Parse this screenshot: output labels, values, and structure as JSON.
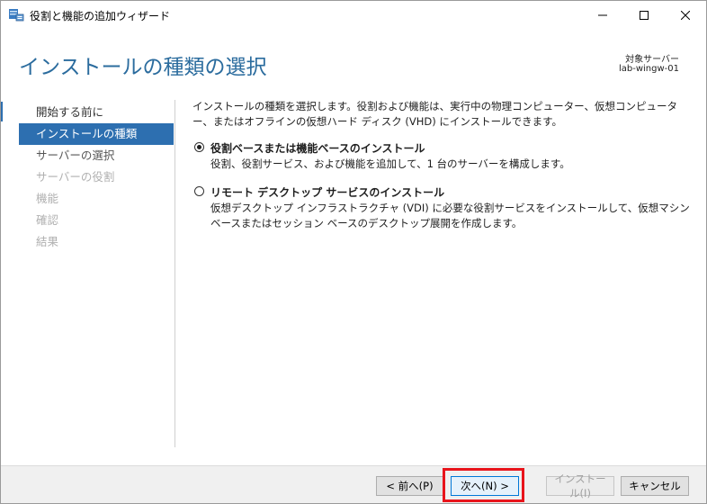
{
  "window": {
    "title": "役割と機能の追加ウィザード",
    "page_title": "インストールの種類の選択",
    "target_label": "対象サーバー",
    "target_name": "lab-wingw-01"
  },
  "nav": {
    "items": [
      {
        "label": "開始する前に",
        "state": "done"
      },
      {
        "label": "インストールの種類",
        "state": "active"
      },
      {
        "label": "サーバーの選択",
        "state": "next"
      },
      {
        "label": "サーバーの役割",
        "state": "disabled"
      },
      {
        "label": "機能",
        "state": "disabled"
      },
      {
        "label": "確認",
        "state": "disabled"
      },
      {
        "label": "結果",
        "state": "disabled"
      }
    ]
  },
  "content": {
    "description": "インストールの種類を選択します。役割および機能は、実行中の物理コンピューター、仮想コンピューター、またはオフラインの仮想ハード ディスク (VHD) にインストールできます。",
    "options": [
      {
        "title": "役割ベースまたは機能ベースのインストール",
        "desc": "役割、役割サービス、および機能を追加して、1 台のサーバーを構成します。",
        "checked": true
      },
      {
        "title": "リモート デスクトップ サービスのインストール",
        "desc": "仮想デスクトップ インフラストラクチャ (VDI) に必要な役割サービスをインストールして、仮想マシン ベースまたはセッション ベースのデスクトップ展開を作成します。",
        "checked": false
      }
    ]
  },
  "footer": {
    "prev_label": "< 前へ(P)",
    "next_label": "次へ(N) >",
    "install_label": "インストール(I)",
    "cancel_label": "キャンセル"
  },
  "colors": {
    "accent": "#2d6fb0",
    "title_blue": "#2b6c9e",
    "highlight": "#e8141b"
  }
}
